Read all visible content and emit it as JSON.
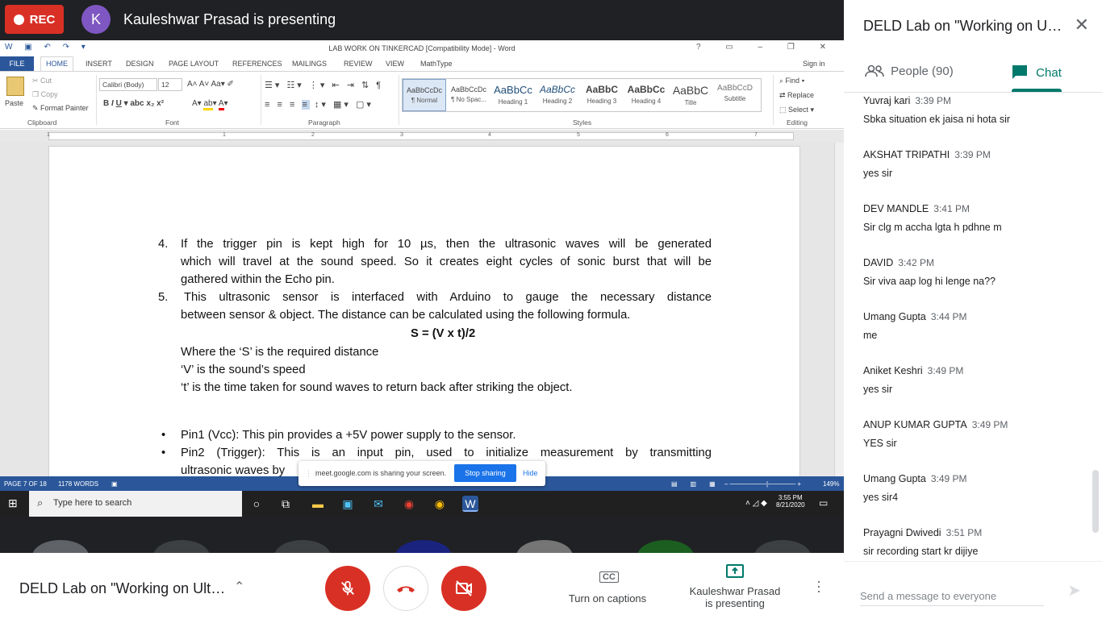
{
  "topbar": {
    "rec_label": "REC",
    "presenter_initial": "K",
    "presenting_text": "Kauleshwar Prasad is presenting"
  },
  "word": {
    "title": "LAB WORK ON TINKERCAD [Compatibility Mode] - Word",
    "signin": "Sign in",
    "tabs": [
      "FILE",
      "HOME",
      "INSERT",
      "DESIGN",
      "PAGE LAYOUT",
      "REFERENCES",
      "MAILINGS",
      "REVIEW",
      "VIEW",
      "MathType"
    ],
    "clipboard": {
      "paste": "Paste",
      "cut": "Cut",
      "copy": "Copy",
      "format_painter": "Format Painter",
      "group": "Clipboard"
    },
    "font": {
      "name": "Calibri (Body)",
      "size": "12",
      "group": "Font"
    },
    "paragraph_group": "Paragraph",
    "styles": [
      {
        "sample": "AaBbCcDc",
        "label": "¶ Normal"
      },
      {
        "sample": "AaBbCcDc",
        "label": "¶ No Spac..."
      },
      {
        "sample": "AaBbCc",
        "label": "Heading 1"
      },
      {
        "sample": "AaBbCc",
        "label": "Heading 2"
      },
      {
        "sample": "AaBbC",
        "label": "Heading 3"
      },
      {
        "sample": "AaBbCc",
        "label": "Heading 4"
      },
      {
        "sample": "AaBbC",
        "label": "Title"
      },
      {
        "sample": "AaBbCcD",
        "label": "Subtitle"
      }
    ],
    "styles_group": "Styles",
    "editing": {
      "find": "Find",
      "replace": "Replace",
      "select": "Select",
      "group": "Editing"
    },
    "ruler_numbers": [
      "1",
      "1",
      "2",
      "3",
      "4",
      "5",
      "6",
      "7"
    ],
    "document": {
      "item4_num": "4.",
      "item4_l1": "If the trigger pin is kept high for 10 µs, then the ultrasonic waves will be generated",
      "item4_l2": "which will travel at the sound speed. So it creates eight cycles of sonic burst that will be",
      "item4_l3": "gathered within the Echo pin.",
      "item5_num": "5.",
      "item5_l1": "This ultrasonic sensor is interfaced with Arduino to gauge the necessary distance",
      "item5_l2": "between sensor & object. The distance can be calculated using the following formula.",
      "formula": "S = (V x t)/2",
      "where_s": "Where the ‘S’ is the required distance",
      "where_v": "‘V’ is the sound’s speed",
      "where_t": "‘t’ is the time taken for sound waves to return back after striking the object.",
      "bullet1": "Pin1 (Vcc): This pin provides a +5V power supply to the sensor.",
      "bullet2_l1": "Pin2 (Trigger): This is an input pin, used to initialize measurement by transmitting",
      "bullet2_l2": "ultrasonic waves by"
    },
    "status": {
      "page": "PAGE 7 OF 18",
      "words": "1178 WORDS",
      "zoom": "149%"
    },
    "share_banner": {
      "text": "meet.google.com is sharing your screen.",
      "stop": "Stop sharing",
      "hide": "Hide"
    },
    "taskbar": {
      "search_placeholder": "Type here to search",
      "time": "3:55 PM",
      "date": "8/21/2020"
    }
  },
  "chat": {
    "meeting_title": "DELD Lab on \"Working on Ult...",
    "people_tab": "People (90)",
    "chat_tab": "Chat",
    "messages": [
      {
        "who": "Yuvraj kari",
        "when": "3:39 PM",
        "text": "Sbka situation ek jaisa ni hota sir"
      },
      {
        "who": "AKSHAT TRIPATHI",
        "when": "3:39 PM",
        "text": "yes sir"
      },
      {
        "who": "DEV MANDLE",
        "when": "3:41 PM",
        "text": "Sir clg m accha lgta h pdhne m"
      },
      {
        "who": "DAVID",
        "when": "3:42 PM",
        "text": "Sir viva aap log hi lenge na??"
      },
      {
        "who": "Umang Gupta",
        "when": "3:44 PM",
        "text": "me"
      },
      {
        "who": "Aniket Keshri",
        "when": "3:49 PM",
        "text": "yes sir"
      },
      {
        "who": "ANUP KUMAR GUPTA",
        "when": "3:49 PM",
        "text": "YES sir"
      },
      {
        "who": "Umang Gupta",
        "when": "3:49 PM",
        "text": "yes sir4"
      },
      {
        "who": "Prayagni Dwivedi",
        "when": "3:51 PM",
        "text": "sir recording start kr dijiye"
      }
    ],
    "compose_placeholder": "Send a message to everyone"
  },
  "bottombar": {
    "meeting_name": "DELD Lab on \"Working on Ultr...",
    "captions_label": "Turn on captions",
    "presenting_l1": "Kauleshwar Prasad",
    "presenting_l2": "is presenting"
  },
  "colors": {
    "accent_red": "#d93025",
    "chat_accent": "#00796b",
    "word_blue": "#2b579a"
  }
}
